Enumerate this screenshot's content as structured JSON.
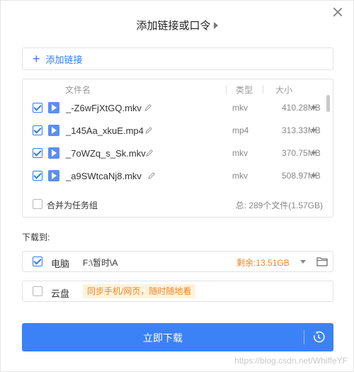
{
  "dialog": {
    "title": "添加链接或口令"
  },
  "add_link": {
    "label": "添加链接"
  },
  "file_list": {
    "columns": {
      "name": "文件名",
      "type": "类型",
      "size": "大小"
    },
    "rows": [
      {
        "name": "_-Z6wFjXtGQ.mkv",
        "type": "mkv",
        "size": "410.28MB",
        "checked": true
      },
      {
        "name": "_145Aa_xkuE.mp4",
        "type": "mp4",
        "size": "313.33MB",
        "checked": true
      },
      {
        "name": "_7oWZq_s_Sk.mkv",
        "type": "mkv",
        "size": "370.75MB",
        "checked": true
      },
      {
        "name": "_a9SWtcaNj8.mkv",
        "type": "mkv",
        "size": "508.97MB",
        "checked": true
      }
    ],
    "merge_label": "合并为任务组",
    "summary": "总:   289个文件(1.57GB)"
  },
  "download_to": {
    "label": "下载到:",
    "computer": {
      "name": "电脑",
      "path": "F:\\暂时\\A",
      "free": "剩余:13.51GB",
      "checked": true
    },
    "cloud": {
      "name": "云盘",
      "tip": "同步手机/网页，随时随地看",
      "checked": false
    }
  },
  "action": {
    "download_label": "立即下载"
  },
  "watermark": "https://blog.csdn.net/WhiffeYF",
  "colors": {
    "accent": "#3b82f6",
    "link": "#2f7bf5",
    "warning": "#e8852b",
    "tip_bg": "#fff3dc"
  }
}
